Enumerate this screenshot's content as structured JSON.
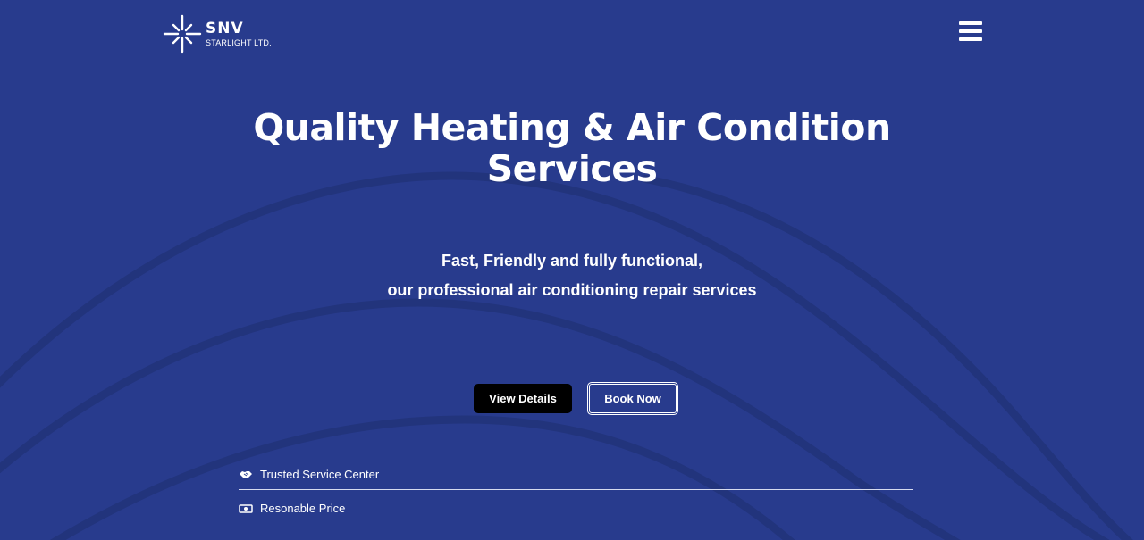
{
  "header": {
    "logo": {
      "name": "SNV",
      "subtitle": "STARLIGHT LTD.",
      "icon": "starburst-logo-icon"
    },
    "menu": {
      "icon": "hamburger-menu-icon"
    }
  },
  "hero": {
    "title": "Quality Heating & Air Condition Services",
    "subtitle_line1": "Fast, Friendly and fully functional,",
    "subtitle_line2": "our professional air conditioning repair services",
    "buttons": {
      "view_details": "View Details",
      "book_now": "Book Now"
    }
  },
  "features": [
    {
      "label": "Trusted Service Center",
      "icon": "handshake-icon"
    },
    {
      "label": "Resonable Price",
      "icon": "money-bill-icon"
    }
  ],
  "colors": {
    "background": "#283b8d",
    "wave": "#22347c",
    "button_dark": "#000000",
    "text": "#ffffff"
  }
}
